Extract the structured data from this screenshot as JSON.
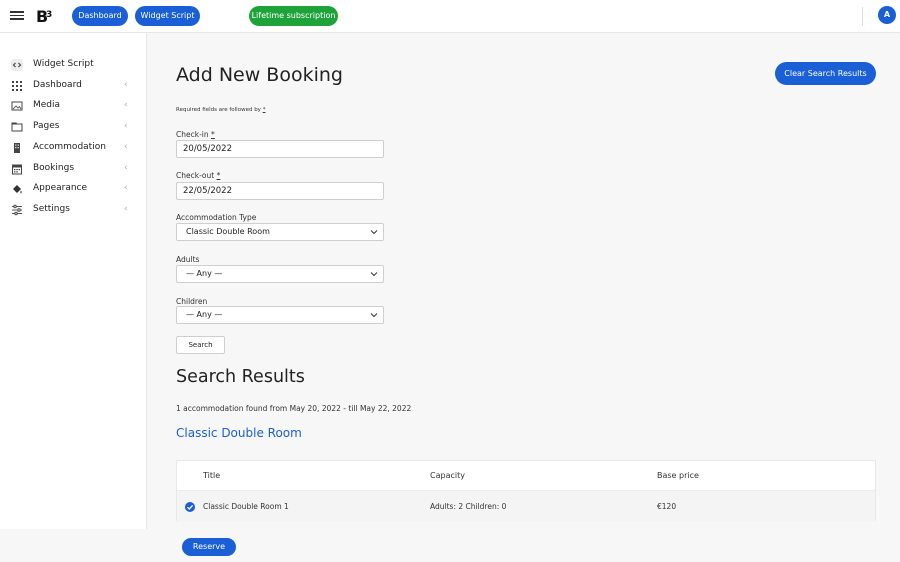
{
  "topbar": {
    "dashboard_label": "Dashboard",
    "widget_label": "Widget Script",
    "lifetime_label": "Lifetime subscription",
    "avatar_initial": "A"
  },
  "sidebar": {
    "items": [
      {
        "label": "Widget Script",
        "icon": "code-icon"
      },
      {
        "label": "Dashboard",
        "icon": "grid-icon"
      },
      {
        "label": "Media",
        "icon": "image-icon"
      },
      {
        "label": "Pages",
        "icon": "folder-icon"
      },
      {
        "label": "Accommodation",
        "icon": "building-icon"
      },
      {
        "label": "Bookings",
        "icon": "calendar-icon"
      },
      {
        "label": "Appearance",
        "icon": "paint-bucket-icon"
      },
      {
        "label": "Settings",
        "icon": "sliders-icon"
      }
    ]
  },
  "main": {
    "title": "Add New Booking",
    "clear_button": "Clear Search Results",
    "required_note": "Required fields are followed by",
    "required_star": "*",
    "form": {
      "checkin_label": "Check-in",
      "checkin_value": "20/05/2022",
      "checkout_label": "Check-out",
      "checkout_value": "22/05/2022",
      "accommodation_label": "Accommodation Type",
      "accommodation_value": "Classic Double Room",
      "adults_label": "Adults",
      "adults_value": "— Any —",
      "children_label": "Children",
      "children_value": "— Any —",
      "search_button": "Search"
    },
    "results": {
      "title": "Search Results",
      "summary": "1 accommodation found from May 20, 2022 - till May 22, 2022",
      "room_name": "Classic Double Room",
      "columns": [
        "Title",
        "Capacity",
        "Base price"
      ],
      "rows": [
        {
          "title": "Classic Double Room 1",
          "capacity": "Adults: 2 Children: 0",
          "price": "€120",
          "selected": true
        }
      ]
    },
    "reserve_button": "Reserve"
  },
  "colors": {
    "accent": "#1a5fd6",
    "success": "#1ea33a"
  }
}
